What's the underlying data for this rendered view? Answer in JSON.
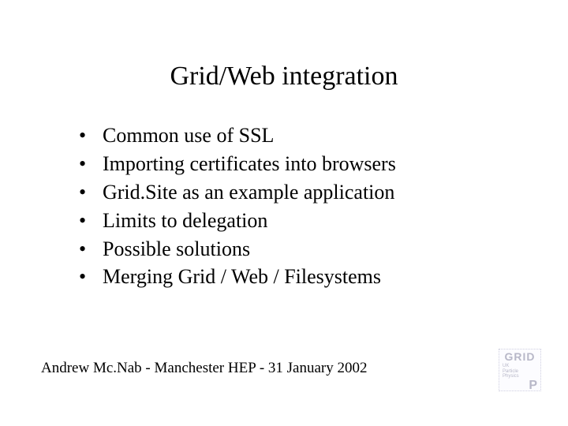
{
  "title": "Grid/Web integration",
  "bullets": [
    "Common use of SSL",
    "Importing certificates into browsers",
    "Grid.Site as an example application",
    "Limits to delegation",
    "Possible solutions",
    "Merging Grid / Web / Filesystems"
  ],
  "footer": "Andrew Mc.Nab - Manchester HEP - 31 January 2002",
  "logo": {
    "line1": "GRID",
    "line2": "UK",
    "line3": "Particle",
    "line4": "Physics",
    "line5": "P"
  }
}
